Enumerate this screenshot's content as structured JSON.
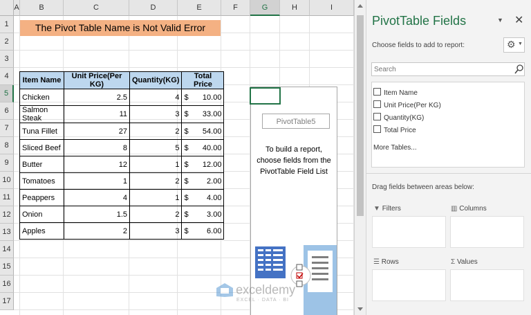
{
  "sheet": {
    "columns": [
      "A",
      "B",
      "C",
      "D",
      "E",
      "F",
      "G",
      "H",
      "I"
    ],
    "selected_column": "G",
    "rows": [
      "1",
      "2",
      "3",
      "4",
      "5",
      "6",
      "7",
      "8",
      "9",
      "10",
      "11",
      "12",
      "13",
      "14",
      "15",
      "16",
      "17"
    ],
    "selected_row": "5",
    "title": "The Pivot Table Name is Not Valid Error",
    "table": {
      "headers": [
        "Item Name",
        "Unit Price(Per KG)",
        "Quantity(KG)",
        "Total Price"
      ],
      "currency_symbol": "$",
      "rows": [
        {
          "item": "Chicken",
          "price": "2.5",
          "qty": "4",
          "total": "10.00"
        },
        {
          "item": "Salmon Steak",
          "price": "11",
          "qty": "3",
          "total": "33.00"
        },
        {
          "item": "Tuna Fillet",
          "price": "27",
          "qty": "2",
          "total": "54.00"
        },
        {
          "item": "Sliced Beef",
          "price": "8",
          "qty": "5",
          "total": "40.00"
        },
        {
          "item": "Butter",
          "price": "12",
          "qty": "1",
          "total": "12.00"
        },
        {
          "item": "Tomatoes",
          "price": "1",
          "qty": "2",
          "total": "2.00"
        },
        {
          "item": "Peappers",
          "price": "4",
          "qty": "1",
          "total": "4.00"
        },
        {
          "item": "Onion",
          "price": "1.5",
          "qty": "2",
          "total": "3.00"
        },
        {
          "item": "Apples",
          "price": "2",
          "qty": "3",
          "total": "6.00"
        }
      ]
    },
    "pivot": {
      "name": "PivotTable5",
      "help_text": "To build a report, choose fields from the PivotTable Field List"
    },
    "watermark": {
      "brand": "exceldemy",
      "tagline": "EXCEL · DATA · BI"
    }
  },
  "pane": {
    "title": "PivotTable Fields",
    "subtitle": "Choose fields to add to report:",
    "search_placeholder": "Search",
    "fields": [
      "Item Name",
      "Unit Price(Per KG)",
      "Quantity(KG)",
      "Total Price"
    ],
    "more_tables": "More Tables...",
    "drag_hint": "Drag fields between areas below:",
    "areas": {
      "filters": "Filters",
      "columns": "Columns",
      "rows": "Rows",
      "values": "Values"
    },
    "accent": "#217346"
  }
}
